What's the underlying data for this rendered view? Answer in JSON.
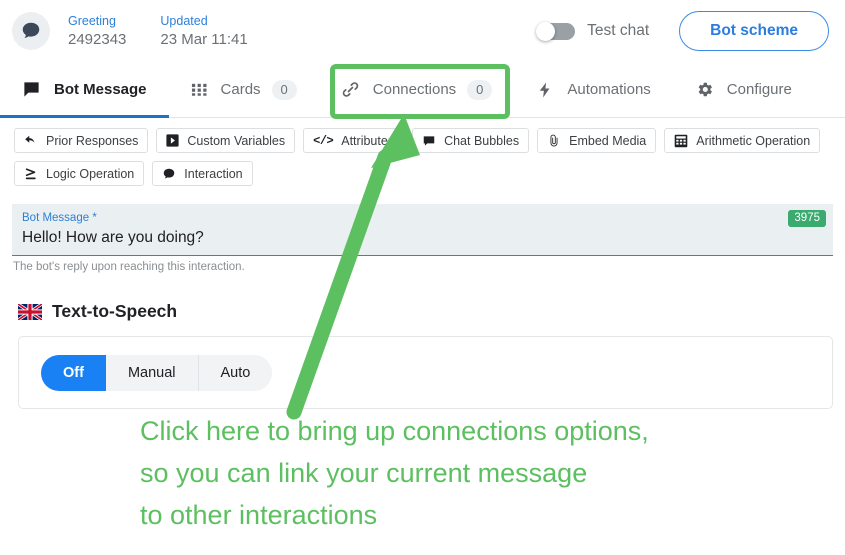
{
  "header": {
    "avatar_icon": "chat-bubble-icon",
    "meta": [
      {
        "label": "Greeting",
        "value": "2492343"
      },
      {
        "label": "Updated",
        "value": "23 Mar 11:41"
      }
    ],
    "toggle": {
      "label": "Test chat",
      "state": "off"
    },
    "bot_scheme_button": "Bot scheme"
  },
  "tabs": [
    {
      "label": "Bot Message",
      "icon": "chat-bubble-icon",
      "badge": null,
      "active": true
    },
    {
      "label": "Cards",
      "icon": "grid-dots-icon",
      "badge": "0",
      "active": false
    },
    {
      "label": "Connections",
      "icon": "link-chain-icon",
      "badge": "0",
      "active": false
    },
    {
      "label": "Automations",
      "icon": "lightning-bolt-icon",
      "badge": null,
      "active": false
    },
    {
      "label": "Configure",
      "icon": "gear-icon",
      "badge": null,
      "active": false
    }
  ],
  "toolbar": [
    {
      "label": "Prior Responses",
      "icon": "undo-arrow-icon"
    },
    {
      "label": "Custom Variables",
      "icon": "play-box-icon"
    },
    {
      "label": "Attributes",
      "icon": "code-brackets-icon"
    },
    {
      "label": "Chat Bubbles",
      "icon": "chat-bubble-icon"
    },
    {
      "label": "Embed Media",
      "icon": "paperclip-icon"
    },
    {
      "label": "Arithmetic Operation",
      "icon": "calculator-icon"
    },
    {
      "label": "Logic Operation",
      "icon": "greater-equal-icon"
    },
    {
      "label": "Interaction",
      "icon": "speech-bubble-icon"
    }
  ],
  "message_field": {
    "label": "Bot Message *",
    "value": "Hello! How are you doing?",
    "counter": "3975",
    "help": "The bot's reply upon reaching this interaction."
  },
  "tts": {
    "title": "Text-to-Speech",
    "flag_icon": "uk-flag-icon",
    "options": [
      {
        "label": "Off",
        "selected": true
      },
      {
        "label": "Manual",
        "selected": false
      },
      {
        "label": "Auto",
        "selected": false
      }
    ]
  },
  "annotation": {
    "line1": "Click here to bring up connections options,",
    "line2": "so you can link your current message",
    "line3": "to other interactions",
    "arrow_icon": "green-arrow-icon",
    "color": "#5cbf60"
  },
  "colors": {
    "accent_blue": "#1a81f5",
    "link_blue": "#2e7fd8",
    "annotation_green": "#5cbf60",
    "counter_green": "#3aaa6e",
    "tab_underline": "#1a73c4"
  }
}
